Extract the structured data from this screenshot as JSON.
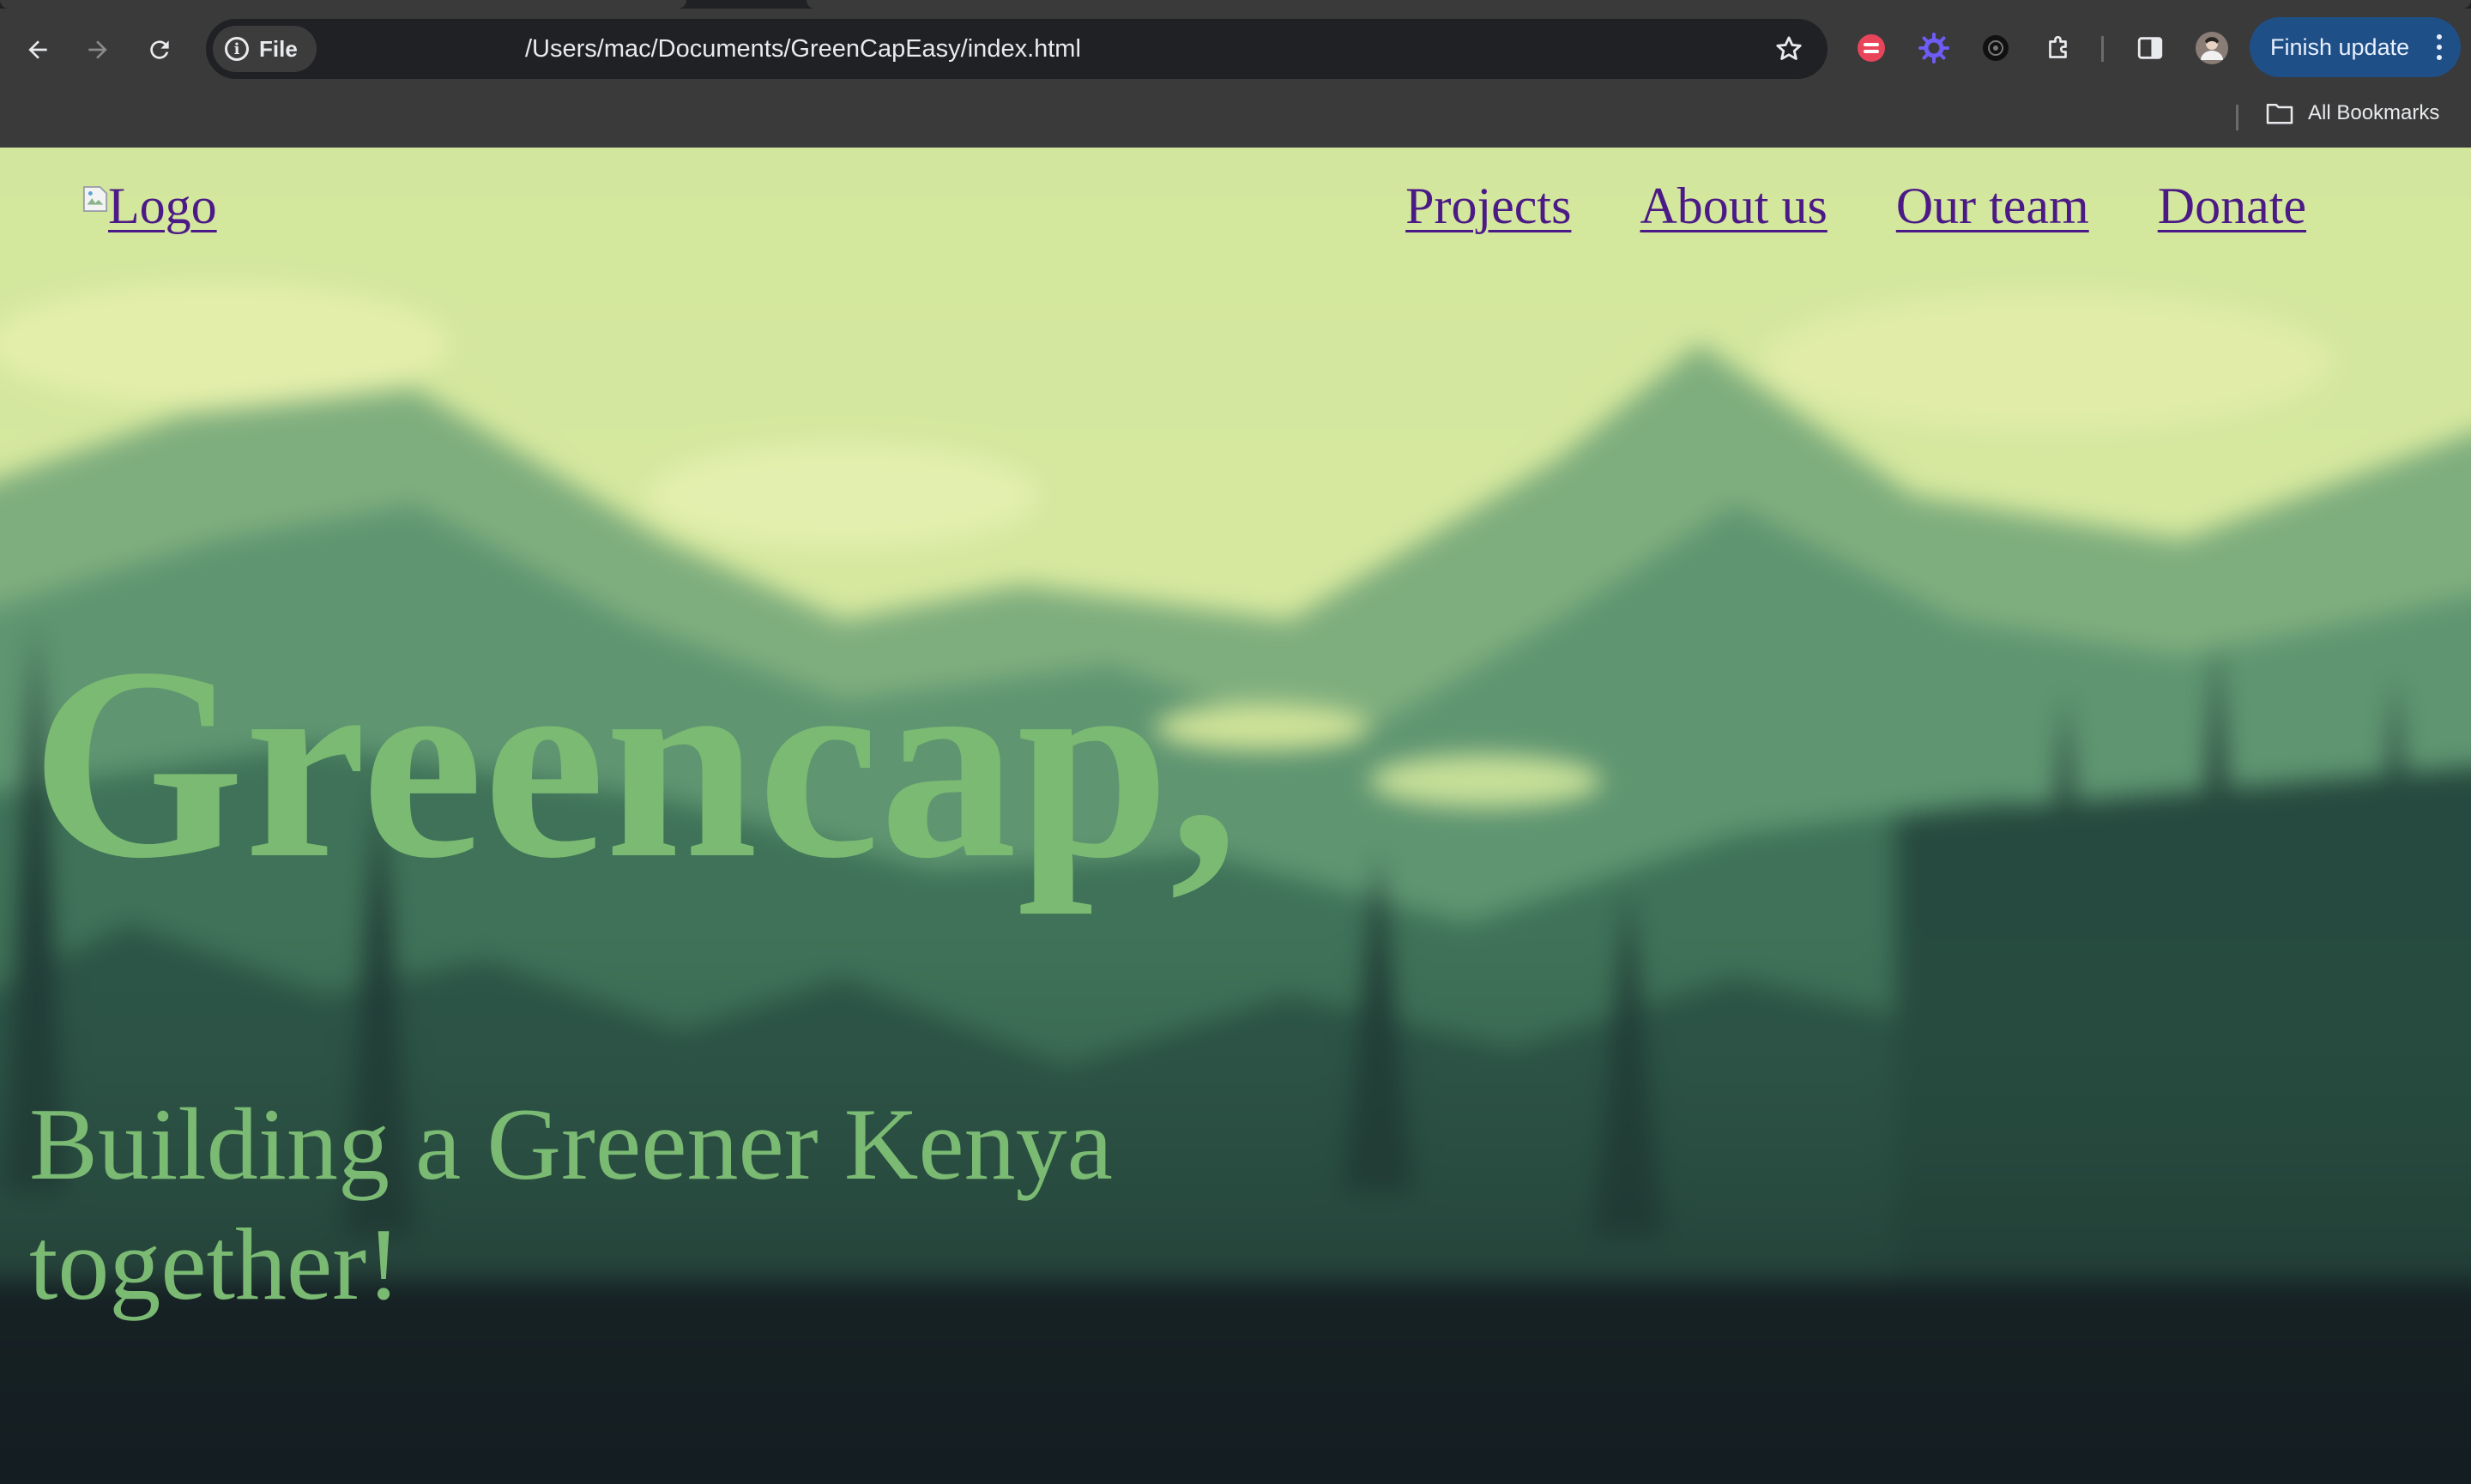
{
  "browser": {
    "site_chip_label": "File",
    "url": "/Users/mac/Documents/GreenCapEasy/index.html",
    "finish_update_label": "Finish update",
    "bookmarks_label": "All Bookmarks",
    "extensions": [
      "red-extension-icon",
      "purple-gear-extension-icon",
      "black-flower-extension-icon",
      "puzzle-extensions-icon"
    ]
  },
  "site": {
    "logo_alt": "Logo",
    "nav": [
      "Projects",
      "About us",
      "Our team",
      "Donate"
    ],
    "hero_title": "Greencap,",
    "hero_subtitle": "Building a Greener Kenya together!"
  },
  "colors": {
    "chrome_bg": "#3a3a3a",
    "omnibox_bg": "#202124",
    "update_button": "#1f4f87",
    "link_visited": "#4b1a86",
    "hero_text": "#7aba72",
    "sky": "#d2e69d",
    "forest_dark": "#151d22"
  }
}
